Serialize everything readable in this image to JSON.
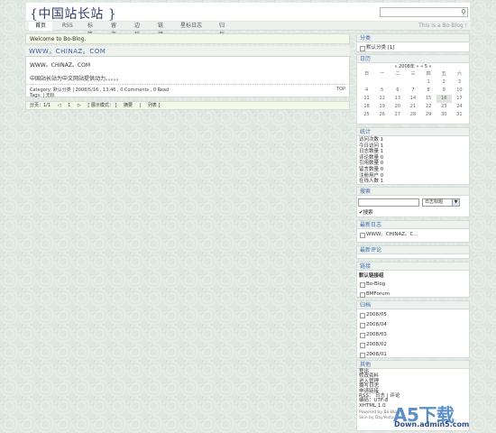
{
  "header": {
    "logo": "{中国站长站 }",
    "tagline": "This is a Bo-Blog !"
  },
  "nav": {
    "items": [
      "首页",
      "RSS",
      "标签",
      "留言",
      "边栏",
      "链接",
      "星标日志",
      "归档"
    ]
  },
  "main": {
    "welcome": "Welcome to Bo-Blog.",
    "post_title": "WWW。CHINAZ。COM",
    "post_line1": "WWW。CHINAZ。COM",
    "post_line2": "中国站长站为中文网站提供动力。。。。。",
    "meta1": "Category: 默认分类 | 2008/5/16 , 13:46 , 0 Comments , 0 Read",
    "meta2": "Tags: | 无标",
    "top": "TOP",
    "pager": [
      "分页：1/1",
      "◁",
      "1",
      "▷",
      "[ 展示模式： ]",
      "摘要",
      "|",
      "列表 ]"
    ]
  },
  "sidebar": {
    "category": {
      "title": "分类",
      "item": "默认分类 [1]"
    },
    "calendar": {
      "title": "日历",
      "month": "« 2008年 » « 5 »",
      "days": [
        "日",
        "一",
        "二",
        "三",
        "四",
        "五",
        "六"
      ],
      "dates": [
        "",
        "",
        "",
        "",
        "1",
        "2",
        "3",
        "4",
        "5",
        "6",
        "7",
        "8",
        "9",
        "10",
        "11",
        "12",
        "13",
        "14",
        "15",
        "16",
        "17",
        "18",
        "19",
        "20",
        "21",
        "22",
        "23",
        "24",
        "25",
        "26",
        "27",
        "28",
        "29",
        "30",
        "31"
      ],
      "today_index": 19
    },
    "stats": {
      "title": "统计",
      "lines": [
        "访问次数 1",
        "今日访问 1",
        "日志数量 1",
        "评论数量 0",
        "引用数量 0",
        "留言数量 0",
        "注册用户 0",
        "在线人数 1"
      ]
    },
    "search": {
      "title": "搜索",
      "select": "日志标题",
      "button": "✔搜索"
    },
    "recent": {
      "title": "最新日志",
      "item": "WWW。CHINAZ。C..."
    },
    "comments": {
      "title": "最新评论"
    },
    "links": {
      "title": "链接",
      "group": "默认链接组",
      "items": [
        "Bo-Blog",
        "BMForum"
      ]
    },
    "archive": {
      "title": "归档",
      "items": [
        "2008/05",
        "2008/04",
        "2008/03",
        "2008/02",
        "2008/01"
      ]
    },
    "other": {
      "title": "其他",
      "lines": [
        "登出",
        "修改资料",
        "进入管理",
        "撰写日志",
        "申请链接",
        "RSS： 日志 | 评论",
        "编码：UTF-8",
        "XHTML 1.0"
      ],
      "powered": "Powered by Bo-Blog",
      "skin": "Skin by DayYesta"
    }
  },
  "watermark": {
    "logo": "A5下载",
    "url": "Down.admin5.com"
  }
}
